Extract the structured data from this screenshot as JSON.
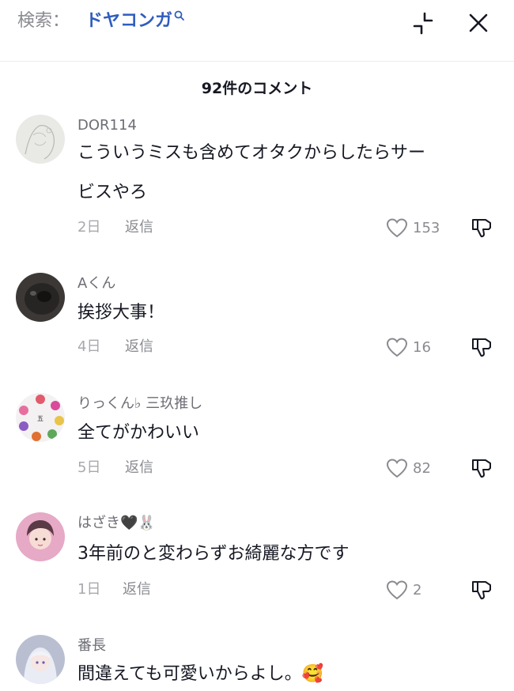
{
  "search": {
    "label": "検索：",
    "query": "ドヤコンガ"
  },
  "icons": {
    "collapse": "collapse-icon",
    "close": "close-icon",
    "like": "heart-icon",
    "dislike": "thumbs-down-icon"
  },
  "colors": {
    "query": "#2f5dbf",
    "text": "#161823",
    "muted": "#8a8b91"
  },
  "comment_count": "92件のコメント",
  "comments": [
    {
      "username": "DOR114",
      "lines": [
        "こういうミスも含めてオタクからしたらサー",
        "ビスやろ"
      ],
      "date": "2日",
      "reply": "返信",
      "likes": "153"
    },
    {
      "username": "Aくん",
      "lines": [
        "挨拶大事！"
      ],
      "date": "4日",
      "reply": "返信",
      "likes": "16"
    },
    {
      "username": "りっくん♭ 三玖推し",
      "lines": [
        "全てがかわいい"
      ],
      "date": "5日",
      "reply": "返信",
      "likes": "82"
    },
    {
      "username": "はざき🖤🐰",
      "lines": [
        "3年前のと変わらずお綺麗な方です"
      ],
      "date": "1日",
      "reply": "返信",
      "likes": "2"
    },
    {
      "username": "番長",
      "lines": [
        "間違えても可愛いからよし。🥰"
      ],
      "date": "",
      "reply": "",
      "likes": ""
    }
  ]
}
